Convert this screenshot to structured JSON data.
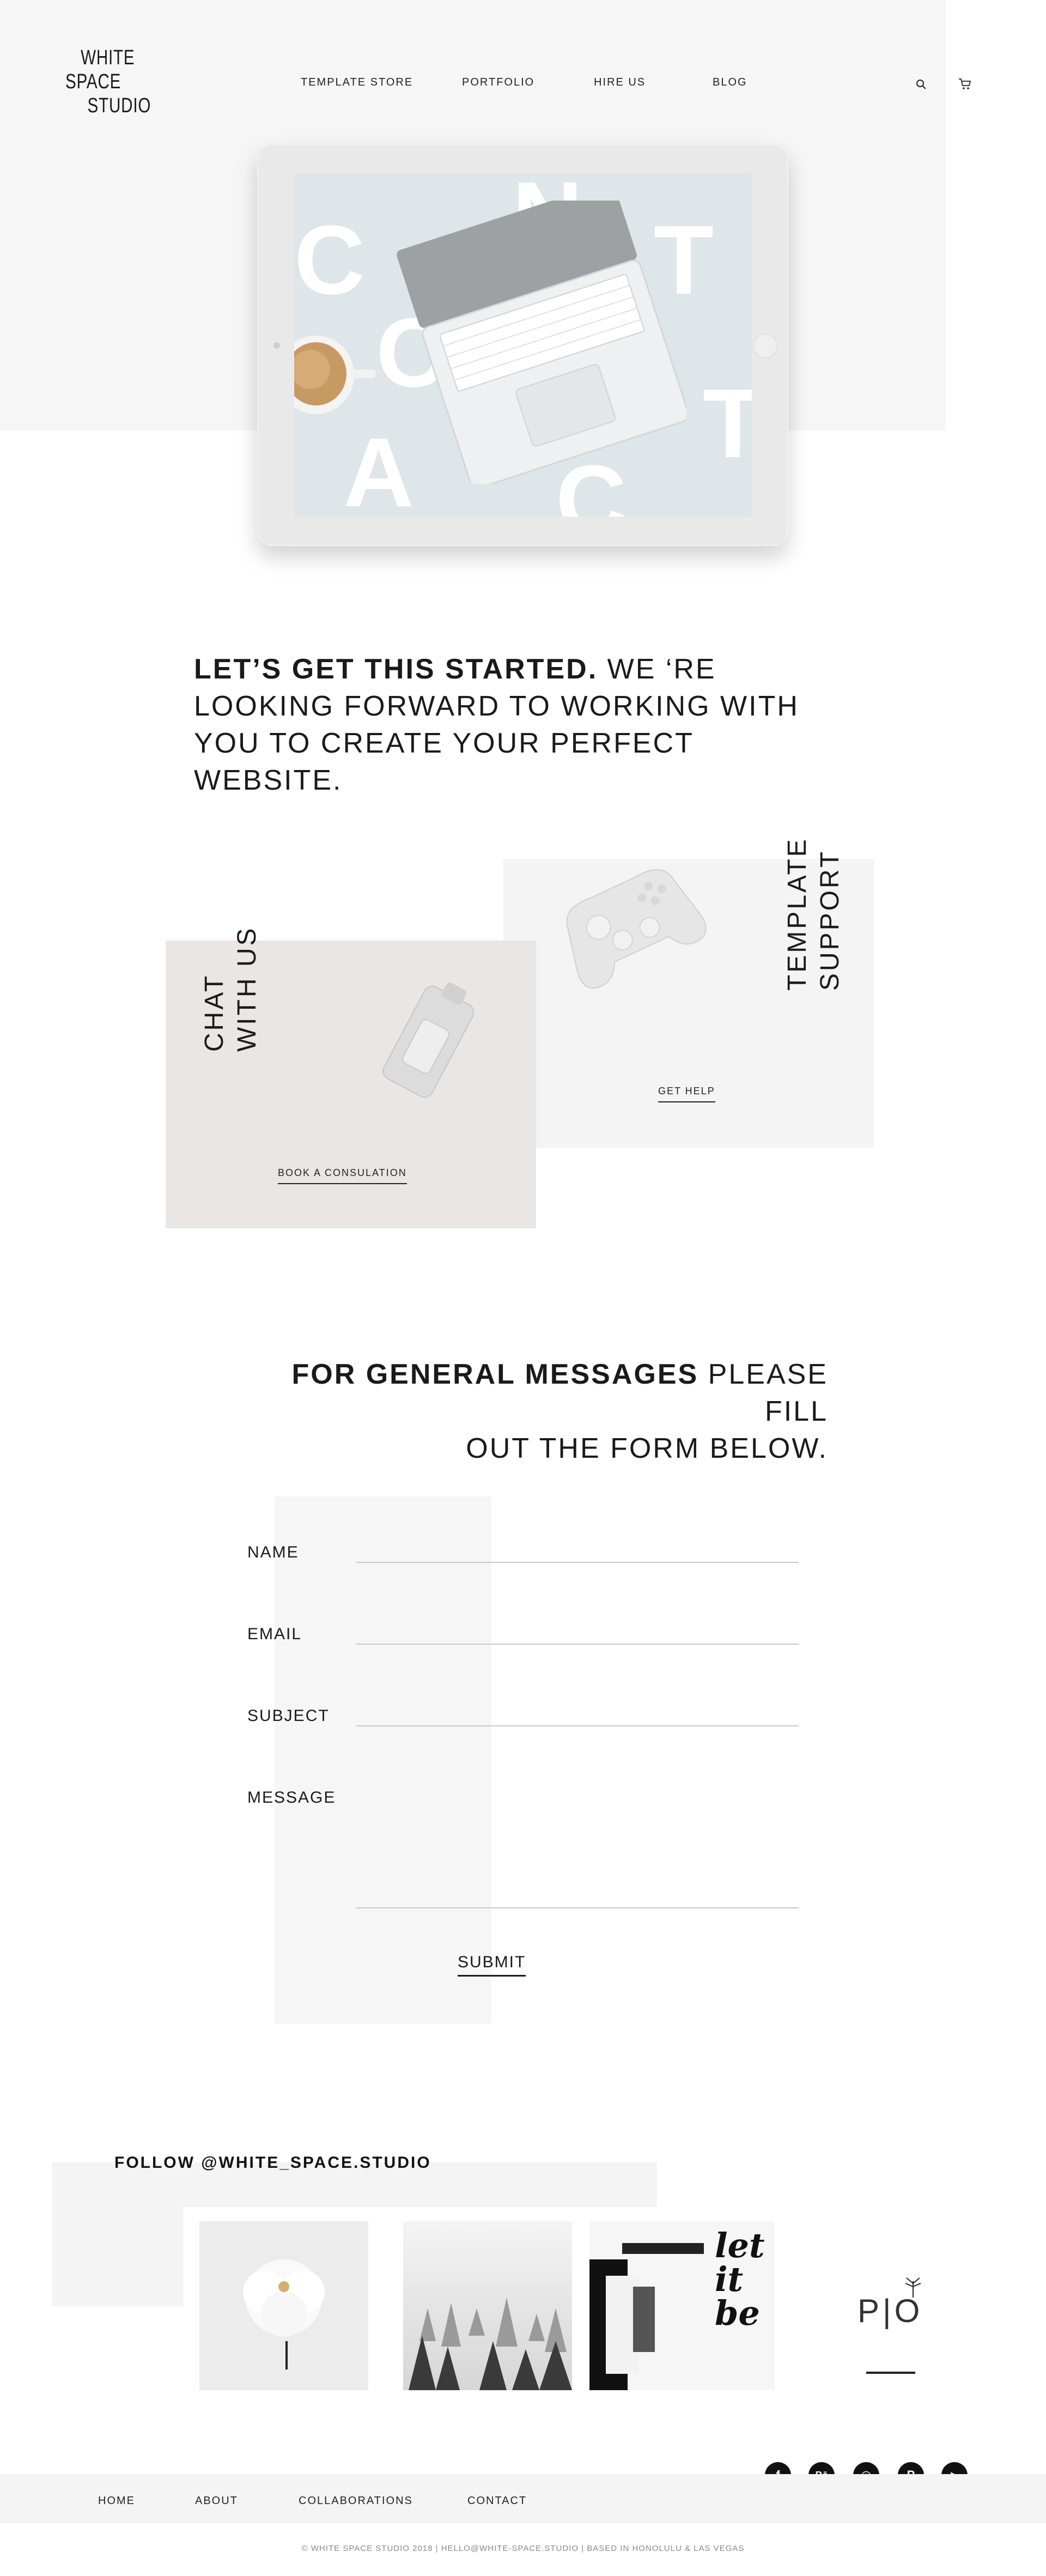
{
  "brand": {
    "logo_line1": "WHITE",
    "logo_line2": "SPACE",
    "logo_line3": "STUDIO"
  },
  "nav": {
    "template_store": "TEMPLATE STORE",
    "portfolio": "PORTFOLIO",
    "hire_us": "HIRE US",
    "blog": "BLOG"
  },
  "header_icons": {
    "search": "search-icon",
    "cart": "cart-icon"
  },
  "hero": {
    "letters": [
      "C",
      "O",
      "N",
      "T",
      "A",
      "C",
      "T"
    ]
  },
  "intro": {
    "bold": "LET’S GET THIS  STARTED.",
    "rest": " WE ‘RE LOOKING FORWARD TO WORKING WITH YOU TO CREATE YOUR PERFECT WEBSITE."
  },
  "cards": {
    "chat": {
      "title_line1": "CHAT",
      "title_line2": "WITH US",
      "link": "BOOK A CONSULATION"
    },
    "support": {
      "title_line1": "TEMPLATE",
      "title_line2": "SUPPORT",
      "link": "GET HELP"
    }
  },
  "general": {
    "bold": "FOR GENERAL MESSAGES",
    "rest_line1": " PLEASE FILL",
    "line2": "OUT THE FORM BELOW."
  },
  "form": {
    "name_label": "NAME",
    "email_label": "EMAIL",
    "subject_label": "SUBJECT",
    "message_label": "MESSAGE",
    "submit_label": "SUBMIT"
  },
  "instagram": {
    "follow": "FOLLOW @WHITE_SPACE.STUDIO",
    "tile3_text": "let it be",
    "tile4_logo": "P|O"
  },
  "social": {
    "facebook": "f",
    "behance": "Bē",
    "instagram": "◎",
    "pinterest": "P",
    "youtube": "▶"
  },
  "footer": {
    "home": "HOME",
    "about": "ABOUT",
    "collaborations": "COLLABORATIONS",
    "contact": "CONTACT",
    "copyright": "© WHITE SPACE STUDIO 2018 |  HELLO@WHITE-SPACE.STUDIO |  BASED IN HONOLULU & LAS VEGAS"
  },
  "colors": {
    "hero_bg": "#f6f6f6",
    "chat_card": "#eae6e3",
    "support_card": "#f4f4f4",
    "screen": "#dfe6ea",
    "text": "#1a1a1a"
  }
}
